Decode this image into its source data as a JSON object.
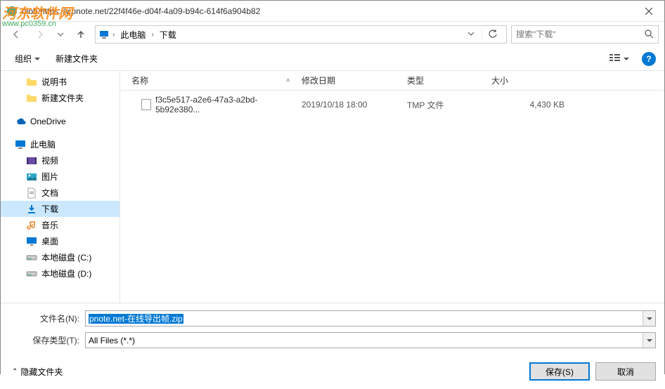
{
  "window": {
    "title": "blob:https://v.pnote.net/22f4f46e-d04f-4a09-b94c-614f6a904b82"
  },
  "watermark": {
    "line1": "河东软件网",
    "line2": "www.pc0359.cn"
  },
  "breadcrumb": {
    "root": "此电脑",
    "folder": "下载"
  },
  "search": {
    "placeholder": "搜索\"下载\""
  },
  "toolbar": {
    "organize": "组织",
    "newfolder": "新建文件夹"
  },
  "columns": {
    "name": "名称",
    "date": "修改日期",
    "type": "类型",
    "size": "大小"
  },
  "sidebar": {
    "docs": "说明书",
    "newfolder": "新建文件夹",
    "onedrive": "OneDrive",
    "thispc": "此电脑",
    "video": "视频",
    "pictures": "图片",
    "documents": "文档",
    "downloads": "下载",
    "music": "音乐",
    "desktop": "桌面",
    "diskC": "本地磁盘 (C:)",
    "diskD": "本地磁盘 (D:)"
  },
  "files": [
    {
      "name": "f3c5e517-a2e6-47a3-a2bd-5b92e380...",
      "date": "2019/10/18 18:00",
      "type": "TMP 文件",
      "size": "4,430 KB"
    }
  ],
  "form": {
    "filename_label": "文件名(N):",
    "filename_value": "pnote.net-在线导出帧.zip",
    "filetype_label": "保存类型(T):",
    "filetype_value": "All Files (*.*)"
  },
  "buttons": {
    "hidefolders": "隐藏文件夹",
    "save": "保存(S)",
    "cancel": "取消"
  }
}
